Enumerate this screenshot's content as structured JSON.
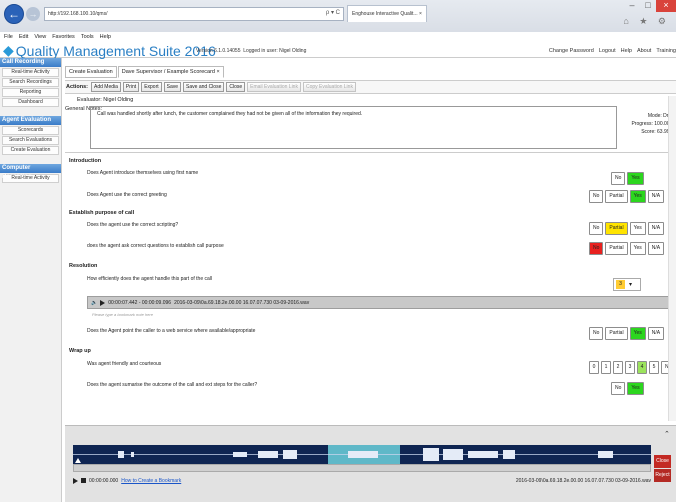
{
  "browser": {
    "url": "http://192.168.100.10/qms/",
    "address_icons": "ρ ▾ C",
    "tab_title": "Enghouse Interactive Qualit... ×",
    "controls": [
      "–",
      "□",
      "×"
    ],
    "toolbar_icons": "⌂ ★ ⚙"
  },
  "menu": [
    "File",
    "Edit",
    "View",
    "Favorites",
    "Tools",
    "Help"
  ],
  "app": {
    "title": "Quality Management Suite 2016",
    "version": "Version 6.1.0.14055",
    "logged_in": "Logged in user: Nigel Olding",
    "topnav": [
      "Change Password",
      "Logout",
      "Help",
      "About",
      "Training"
    ]
  },
  "sidebar": {
    "sections": [
      {
        "head": "Call Recording",
        "items": [
          "Real-time Activity",
          "Search Recordings",
          "Reporting",
          "Dashboard"
        ]
      },
      {
        "head": "Agent Evaluation",
        "items": [
          "Scorecards",
          "Search Evaluations",
          "Create Evaluation"
        ]
      },
      {
        "head": "Computer Recording",
        "items": [
          "Real-time Activity"
        ]
      }
    ]
  },
  "tabs": [
    "Create Evaluation",
    "Dave Supervisor / Example Scorecard ×"
  ],
  "actions": {
    "label": "Actions:",
    "buttons": [
      "Add Media",
      "Print",
      "Export",
      "Save",
      "Save and Close",
      "Close"
    ],
    "disabled": [
      "Email Evaluation Link",
      "Copy Evaluation Link"
    ]
  },
  "evaluator": "Evaluator: Nigel Olding",
  "notes": {
    "label": "General Notes:",
    "text": "Call was handled shortly after lunch, the customer complained they had not be given all of the information they required."
  },
  "status": {
    "mode": "Mode: Draft",
    "progress": "Progress: 100.00%",
    "score": "Score: 63.99%"
  },
  "sections": {
    "introduction": "Introduction",
    "q1": "Does Agent introduce themselves using first name",
    "q2": "Does Agent use the correct greeting",
    "purpose": "Establish purpose of call",
    "q3": "Does the agent use the correct scripting?",
    "q4": "does the agent ask correct questions to establish call purpose",
    "resolution": "Resolution",
    "q5": "How efficiently does the agent handle this part of the call",
    "q5_value": "3",
    "q6": "Does the Agent point the caller to a web service where available/appropriate",
    "wrapup": "Wrap up",
    "q7": "Was agent friendly and courteous",
    "q8": "Does the agent sumarise the outcome of the call and ext steps for the caller?"
  },
  "answers": {
    "no": "No",
    "yes": "Yes",
    "partial": "Partial",
    "na": "N/A",
    "scale": [
      "0",
      "1",
      "2",
      "3",
      "4",
      "5"
    ]
  },
  "player": {
    "time": "00:00:07.442 - 00:00:09.096",
    "file": "2016-03-09\\0a.69.18.2e.00.00 16.07.07.730 03-09-2016.wav",
    "bookmark_placeholder": "Please type a bookmark note here"
  },
  "bottom": {
    "time": "00:00:00.000",
    "link": "How to Create a Bookmark",
    "file": "2016-03-09\\0a.69.18.2e.00.00 16.07.07.730 03-09-2016.wav",
    "close": "Close",
    "reject": "Reject"
  }
}
